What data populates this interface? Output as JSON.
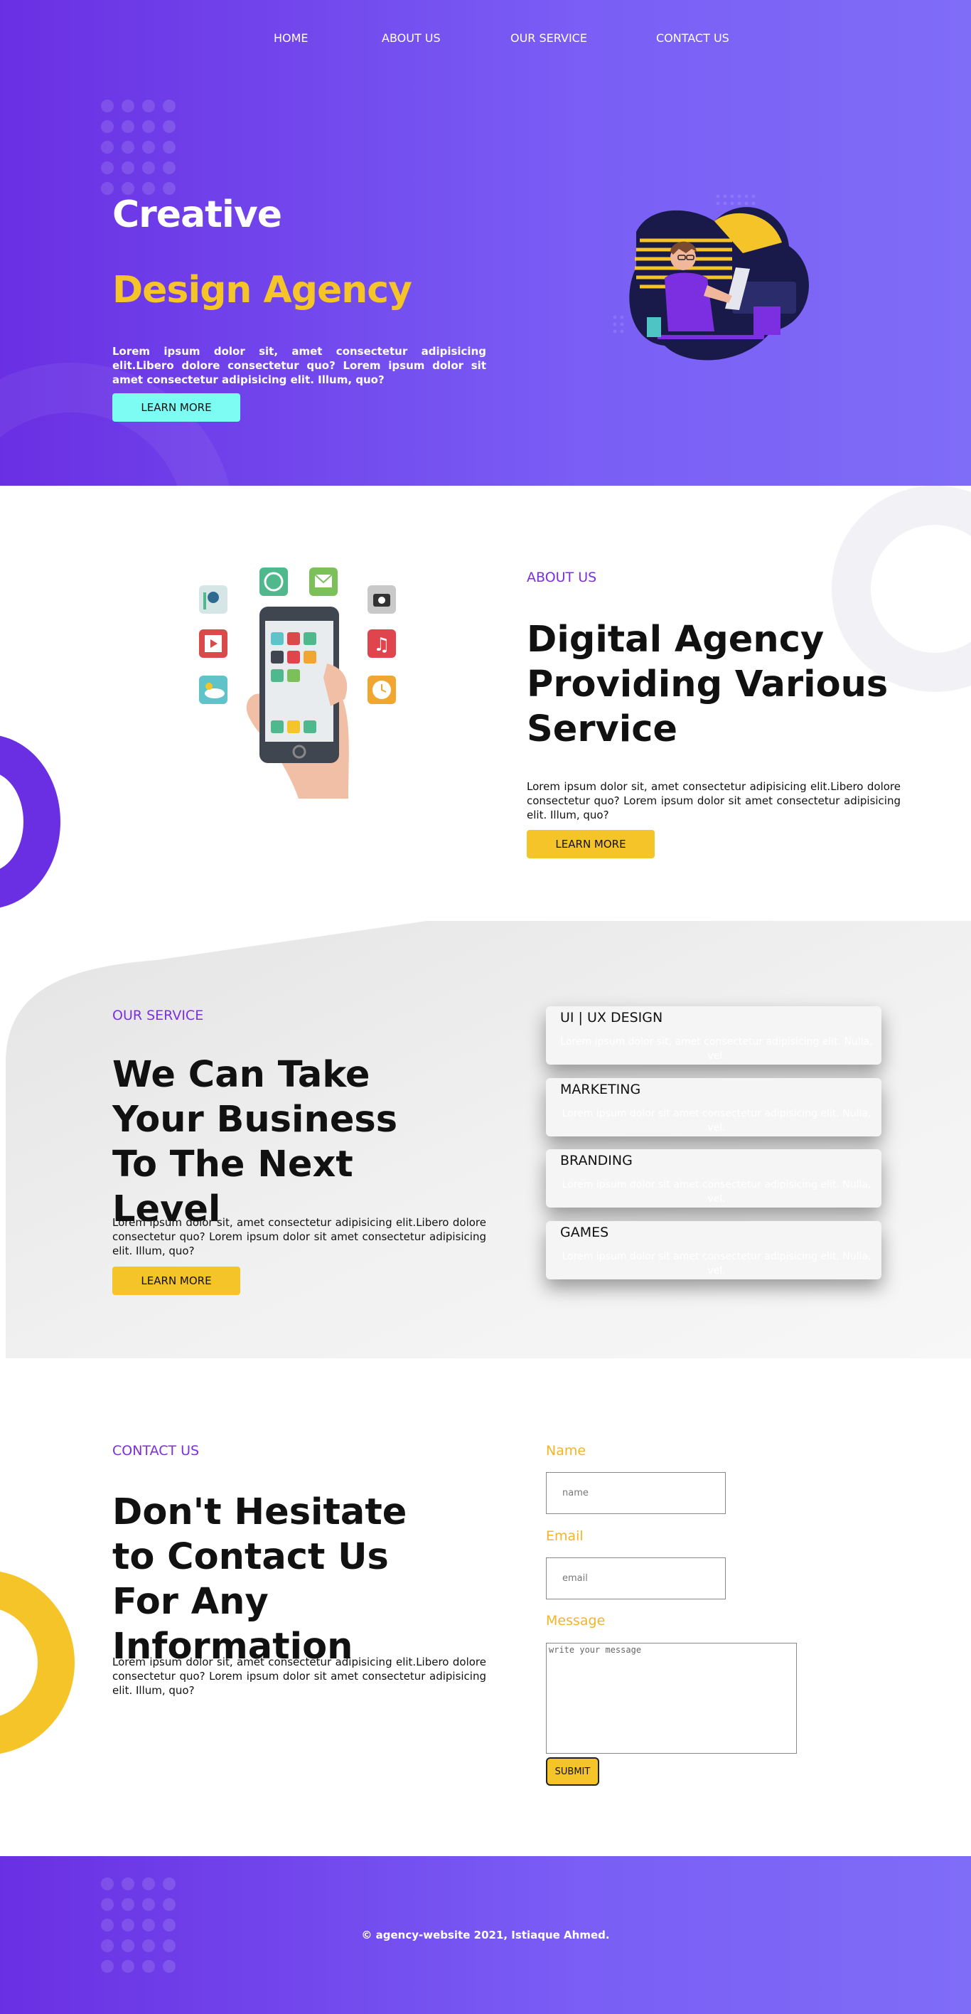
{
  "nav": {
    "items": [
      "HOME",
      "ABOUT US",
      "OUR SERVICE",
      "CONTACT US"
    ]
  },
  "hero": {
    "title": "Creative",
    "subtitle": "Design Agency",
    "text": "Lorem ipsum dolor sit, amet consectetur adipisicing elit.Libero dolore consectetur quo? Lorem ipsum dolor sit amet consectetur adipisicing elit. Illum, quo?",
    "button": "LEARN MORE"
  },
  "about": {
    "label": "ABOUT US",
    "title": "Digital Agency Providing Various Service",
    "text": "Lorem ipsum dolor sit, amet consectetur adipisicing elit.Libero dolore consectetur quo? Lorem ipsum dolor sit amet consectetur adipisicing elit. Illum, quo?",
    "button": "LEARN MORE"
  },
  "service": {
    "label": "OUR SERVICE",
    "title": "We Can Take Your Business To The Next Level",
    "text": "Lorem ipsum dolor sit, amet consectetur adipisicing elit.Libero dolore consectetur quo? Lorem ipsum dolor sit amet consectetur adipisicing elit. Illum, quo?",
    "button": "LEARN MORE",
    "cards": [
      {
        "title": "UI | UX DESIGN",
        "text": "Lorem ipsum dolor sit, amet consectetur adipisicing elit. Nulla, vel."
      },
      {
        "title": "MARKETING",
        "text": "Lorem ipsum dolor sit amet consectetur adipisicing elit. Nulla, vel."
      },
      {
        "title": "BRANDING",
        "text": "Lorem ipsum dolor sit amet consectetur adipisicing elit. Nulla, vel."
      },
      {
        "title": "GAMES",
        "text": "Lorem ipsum dolor sit amet consectetur adipisicing elit. Nulla, vel."
      }
    ]
  },
  "contact": {
    "label": "CONTACT US",
    "title": "Don't Hesitate to Contact Us For Any Information",
    "text": "Lorem ipsum dolor sit, amet consectetur adipisicing elit.Libero dolore consectetur quo? Lorem ipsum dolor sit amet consectetur adipisicing elit. Illum, quo?",
    "form": {
      "name_label": "Name",
      "name_placeholder": "name",
      "email_label": "Email",
      "email_placeholder": "email",
      "message_label": "Message",
      "message_placeholder": "write your message",
      "submit": "SUBMIT"
    }
  },
  "footer": {
    "text": "© agency-website 2021, Istiaque Ahmed."
  },
  "colors": {
    "primary_purple": "#6a2fe3",
    "accent_yellow": "#f5c428",
    "accent_cyan": "#7dfcf4"
  }
}
